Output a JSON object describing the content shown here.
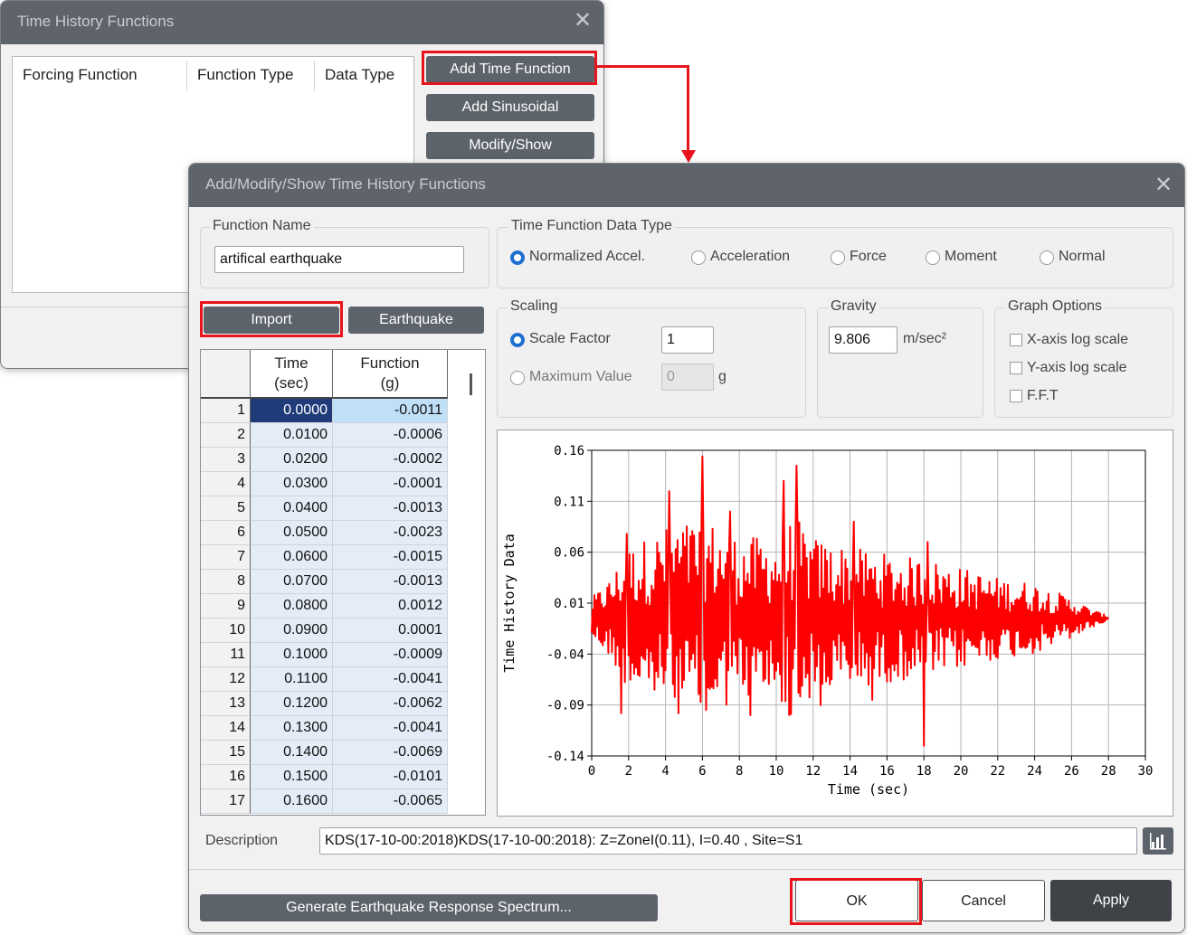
{
  "bg_dialog": {
    "title": "Time History Functions",
    "columns": [
      "Forcing Function",
      "Function Type",
      "Data Type"
    ],
    "buttons": {
      "add_time_function": "Add Time Function",
      "add_sinusoidal": "Add Sinusoidal",
      "modify_show": "Modify/Show"
    }
  },
  "dialog": {
    "title": "Add/Modify/Show Time History Functions",
    "function_name": {
      "label": "Function Name",
      "value": "artifical earthquake"
    },
    "data_type": {
      "label": "Time Function Data Type",
      "options": [
        "Normalized Accel.",
        "Acceleration",
        "Force",
        "Moment",
        "Normal"
      ],
      "selected": "Normalized Accel."
    },
    "import_label": "Import",
    "earthquake_label": "Earthquake",
    "scaling": {
      "label": "Scaling",
      "scale_factor_label": "Scale Factor",
      "scale_factor_value": "1",
      "max_value_label": "Maximum Value",
      "max_value_value": "0",
      "max_value_unit": "g",
      "selected": "Scale Factor"
    },
    "gravity": {
      "label": "Gravity",
      "value": "9.806",
      "unit": "m/sec²"
    },
    "graph_options": {
      "label": "Graph Options",
      "items": [
        "X-axis log scale",
        "Y-axis log scale",
        "F.F.T"
      ]
    },
    "table": {
      "headers": [
        [
          "Time",
          "(sec)"
        ],
        [
          "Function",
          "(g)"
        ]
      ],
      "rows": [
        [
          "1",
          "0.0000",
          "-0.0011"
        ],
        [
          "2",
          "0.0100",
          "-0.0006"
        ],
        [
          "3",
          "0.0200",
          "-0.0002"
        ],
        [
          "4",
          "0.0300",
          "-0.0001"
        ],
        [
          "5",
          "0.0400",
          "-0.0013"
        ],
        [
          "6",
          "0.0500",
          "-0.0023"
        ],
        [
          "7",
          "0.0600",
          "-0.0015"
        ],
        [
          "8",
          "0.0700",
          "-0.0013"
        ],
        [
          "9",
          "0.0800",
          "0.0012"
        ],
        [
          "10",
          "0.0900",
          "0.0001"
        ],
        [
          "11",
          "0.1000",
          "-0.0009"
        ],
        [
          "12",
          "0.1100",
          "-0.0041"
        ],
        [
          "13",
          "0.1200",
          "-0.0062"
        ],
        [
          "14",
          "0.1300",
          "-0.0041"
        ],
        [
          "15",
          "0.1400",
          "-0.0069"
        ],
        [
          "16",
          "0.1500",
          "-0.0101"
        ],
        [
          "17",
          "0.1600",
          "-0.0065"
        ]
      ]
    },
    "description": {
      "label": "Description",
      "value": "KDS(17-10-00:2018)KDS(17-10-00:2018): Z=ZoneI(0.11), I=0.40 , Site=S1"
    },
    "buttons": {
      "generate": "Generate Earthquake Response Spectrum...",
      "ok": "OK",
      "cancel": "Cancel",
      "apply": "Apply"
    }
  },
  "chart_data": {
    "type": "line",
    "xlabel": "Time (sec)",
    "ylabel": "Time History Data",
    "xlim": [
      0,
      30
    ],
    "ylim": [
      -0.14,
      0.16
    ],
    "xticks": [
      "0",
      "2",
      "4",
      "6",
      "8",
      "10",
      "12",
      "14",
      "16",
      "18",
      "20",
      "22",
      "24",
      "26",
      "28",
      "30"
    ],
    "yticks": [
      "0.16",
      "0.11",
      "0.06",
      "0.01",
      "-0.04",
      "-0.09",
      "-0.14"
    ],
    "grid": true,
    "series": [
      {
        "color": "#ff0000",
        "duration": 28,
        "envelope": [
          [
            0,
            0.02
          ],
          [
            1,
            0.04
          ],
          [
            2,
            0.07
          ],
          [
            4,
            0.09
          ],
          [
            6,
            0.1
          ],
          [
            8,
            0.08
          ],
          [
            10,
            0.08
          ],
          [
            11,
            0.1
          ],
          [
            12,
            0.08
          ],
          [
            14,
            0.07
          ],
          [
            17,
            0.06
          ],
          [
            18,
            0.06
          ],
          [
            20,
            0.05
          ],
          [
            22,
            0.04
          ],
          [
            24,
            0.035
          ],
          [
            26,
            0.02
          ],
          [
            27,
            0.01
          ],
          [
            28,
            0.002
          ]
        ],
        "peaks": [
          [
            1.6,
            -0.098
          ],
          [
            1.9,
            0.078
          ],
          [
            4.2,
            0.12
          ],
          [
            6,
            0.154
          ],
          [
            6.2,
            -0.095
          ],
          [
            7.5,
            0.1
          ],
          [
            8.6,
            -0.1
          ],
          [
            10.4,
            0.13
          ],
          [
            10.7,
            -0.1
          ],
          [
            11.1,
            0.145
          ],
          [
            12.4,
            -0.09
          ],
          [
            14.2,
            0.09
          ],
          [
            15.2,
            -0.085
          ],
          [
            18,
            -0.13
          ],
          [
            18.2,
            0.07
          ]
        ]
      }
    ]
  }
}
